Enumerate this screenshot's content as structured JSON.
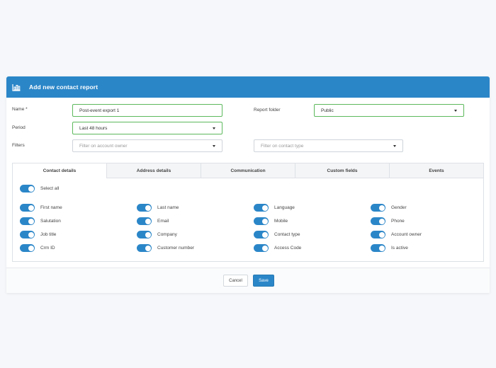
{
  "header": {
    "title": "Add new contact report",
    "icon": "bar-chart-icon",
    "color": "#2b86c8"
  },
  "form": {
    "name_label": "Name *",
    "name_value": "Post-event export 1",
    "report_folder_label": "Report folder",
    "report_folder_value": "Public",
    "period_label": "Period",
    "period_value": "Last 48 hours",
    "filters_label": "Filters",
    "filter_account_owner_placeholder": "Filter on account owner",
    "filter_contact_type_placeholder": "Filter on contact type"
  },
  "tabs": [
    {
      "label": "Contact details",
      "active": true
    },
    {
      "label": "Address details",
      "active": false
    },
    {
      "label": "Communication",
      "active": false
    },
    {
      "label": "Custom fields",
      "active": false
    },
    {
      "label": "Events",
      "active": false
    }
  ],
  "fields": {
    "select_all": "Select all",
    "columns": [
      [
        "First name",
        "Salutation",
        "Job title",
        "Crm ID"
      ],
      [
        "Last name",
        "Email",
        "Company",
        "Customer number"
      ],
      [
        "Language",
        "Mobile",
        "Contact type",
        "Access Code"
      ],
      [
        "Gender",
        "Phone",
        "Account owner",
        "Is active"
      ]
    ]
  },
  "footer": {
    "cancel_label": "Cancel",
    "save_label": "Save"
  }
}
